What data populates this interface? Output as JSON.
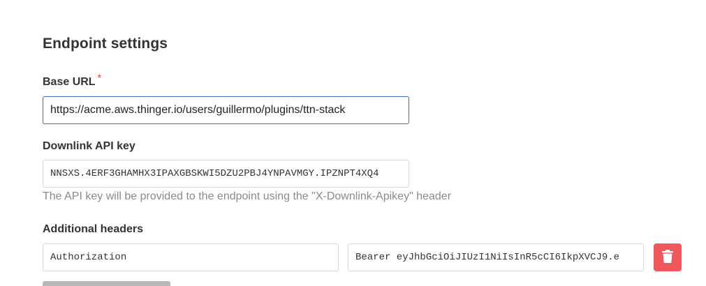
{
  "section": {
    "title": "Endpoint settings"
  },
  "base_url": {
    "label": "Base URL",
    "required_mark": "*",
    "value": "https://acme.aws.thinger.io/users/guillermo/plugins/ttn-stack"
  },
  "downlink_api_key": {
    "label": "Downlink API key",
    "value": "NNSXS.4ERF3GHAMHX3IPAXGBSKWI5DZU2PBJ4YNPAVMGY.IPZNPT4XQ4",
    "help": "The API key will be provided to the endpoint using the \"X-Downlink-Apikey\" header"
  },
  "additional_headers": {
    "label": "Additional headers",
    "rows": [
      {
        "key": "Authorization",
        "value": "Bearer eyJhbGciOiJIUzI1NiIsInR5cCI6IkpXVCJ9.e",
        "delete_icon": "trash-icon"
      }
    ]
  },
  "colors": {
    "accent_border": "#3f6fb3",
    "danger": "#f0585d",
    "required": "#e53935"
  }
}
